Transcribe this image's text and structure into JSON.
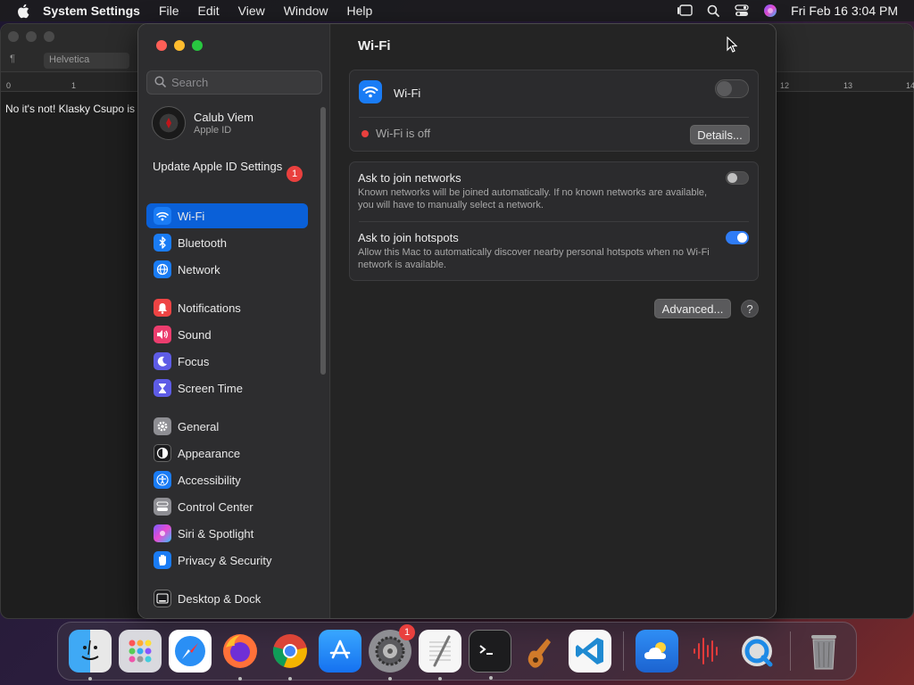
{
  "menubar": {
    "app_name": "System Settings",
    "items": [
      "File",
      "Edit",
      "View",
      "Window",
      "Help"
    ],
    "clock": "Fri Feb 16  3:04 PM"
  },
  "editor": {
    "paragraph_symbol": "¶",
    "font_name": "Helvetica",
    "ruler_ticks": [
      "0",
      "1",
      "12",
      "13",
      "14"
    ],
    "document_text": "No it's not! Klasky Csupo is"
  },
  "sidebar": {
    "search_placeholder": "Search",
    "profile_name": "Calub Viem",
    "profile_sub": "Apple ID",
    "update_label": "Update Apple ID Settings",
    "update_badge": "1",
    "items": [
      {
        "label": "Wi-Fi"
      },
      {
        "label": "Bluetooth"
      },
      {
        "label": "Network"
      },
      {
        "label": "Notifications"
      },
      {
        "label": "Sound"
      },
      {
        "label": "Focus"
      },
      {
        "label": "Screen Time"
      },
      {
        "label": "General"
      },
      {
        "label": "Appearance"
      },
      {
        "label": "Accessibility"
      },
      {
        "label": "Control Center"
      },
      {
        "label": "Siri & Spotlight"
      },
      {
        "label": "Privacy & Security"
      },
      {
        "label": "Desktop & Dock"
      }
    ]
  },
  "main": {
    "title": "Wi-Fi",
    "wifi_label": "Wi-Fi",
    "wifi_status": "Wi-Fi is off",
    "details_button": "Details...",
    "ask_networks_title": "Ask to join networks",
    "ask_networks_desc": "Known networks will be joined automatically. If no known networks are available, you will have to manually select a network.",
    "ask_hotspots_title": "Ask to join hotspots",
    "ask_hotspots_desc": "Allow this Mac to automatically discover nearby personal hotspots when no Wi-Fi network is available.",
    "advanced_button": "Advanced...",
    "help_button": "?"
  },
  "dock": {
    "settings_badge": "1"
  }
}
